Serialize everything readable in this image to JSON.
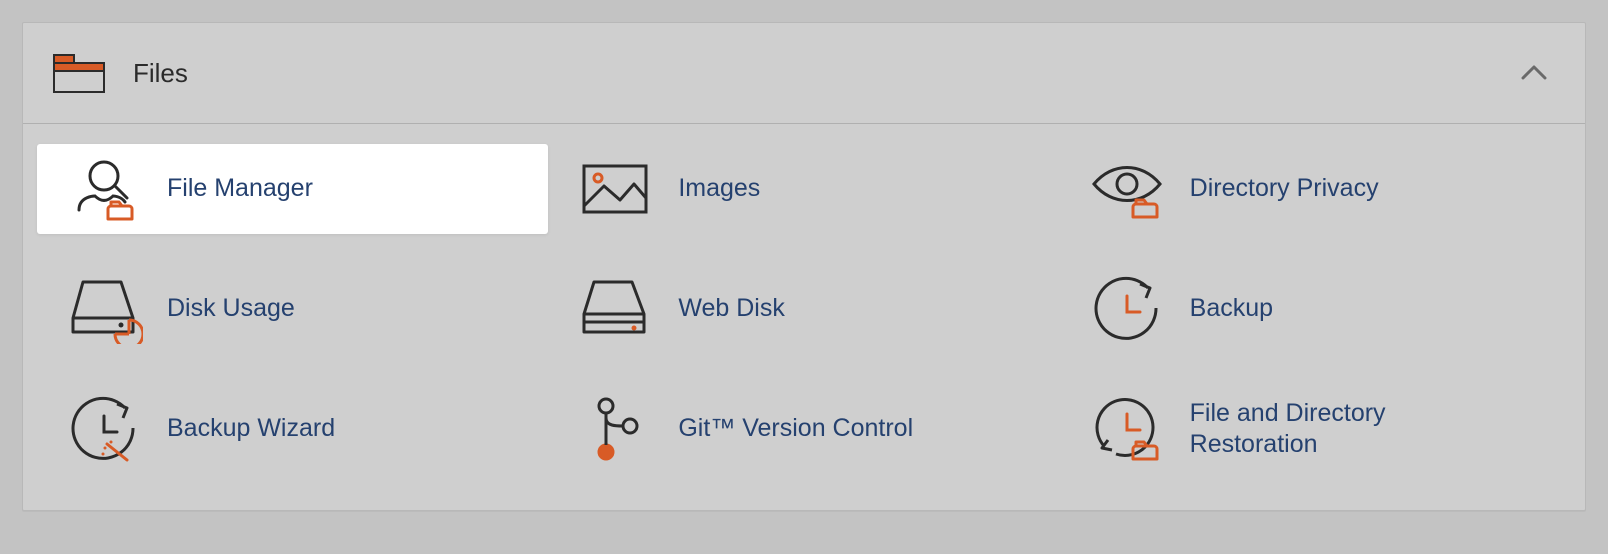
{
  "section": {
    "title": "Files",
    "expanded": true,
    "items": [
      {
        "key": "file-manager",
        "label": "File Manager",
        "icon": "file-manager-icon",
        "highlighted": true
      },
      {
        "key": "images",
        "label": "Images",
        "icon": "images-icon",
        "highlighted": false
      },
      {
        "key": "directory-privacy",
        "label": "Directory Privacy",
        "icon": "directory-privacy-icon",
        "highlighted": false
      },
      {
        "key": "disk-usage",
        "label": "Disk Usage",
        "icon": "disk-usage-icon",
        "highlighted": false
      },
      {
        "key": "web-disk",
        "label": "Web Disk",
        "icon": "web-disk-icon",
        "highlighted": false
      },
      {
        "key": "backup",
        "label": "Backup",
        "icon": "backup-icon",
        "highlighted": false
      },
      {
        "key": "backup-wizard",
        "label": "Backup Wizard",
        "icon": "backup-wizard-icon",
        "highlighted": false
      },
      {
        "key": "git-version-control",
        "label": "Git™ Version Control",
        "icon": "git-icon",
        "highlighted": false
      },
      {
        "key": "file-directory-restoration",
        "label": "File and Directory Restoration",
        "icon": "restoration-icon",
        "highlighted": false
      }
    ]
  },
  "colors": {
    "accent": "#d85b26",
    "link": "#25416f",
    "stroke": "#2b2b2b"
  }
}
